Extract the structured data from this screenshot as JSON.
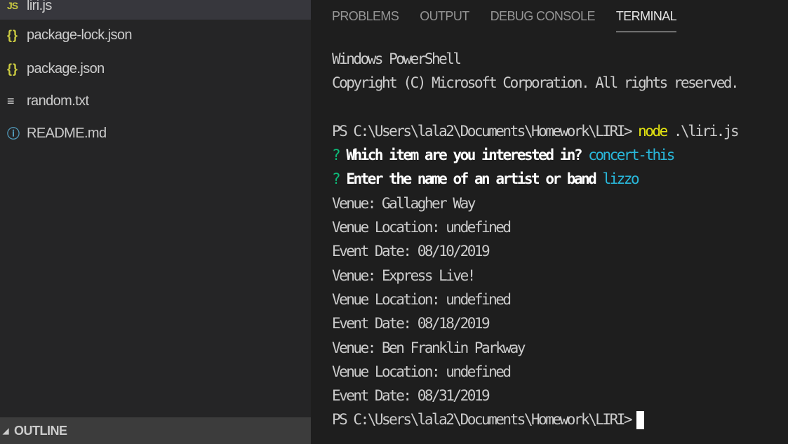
{
  "explorer": {
    "files": [
      {
        "icon": "javascript-file-icon",
        "icon_text": "JS",
        "label": "liri.js"
      },
      {
        "icon": "json-file-icon",
        "icon_text": "{}",
        "label": "package-lock.json"
      },
      {
        "icon": "json-file-icon",
        "icon_text": "{}",
        "label": "package.json"
      },
      {
        "icon": "text-file-icon",
        "icon_text": "≡",
        "label": "random.txt"
      },
      {
        "icon": "info-file-icon",
        "icon_text": "ⓘ",
        "label": "README.md"
      }
    ],
    "outline_label": "OUTLINE"
  },
  "panel": {
    "tabs": [
      "PROBLEMS",
      "OUTPUT",
      "DEBUG CONSOLE",
      "TERMINAL"
    ],
    "active_tab": "TERMINAL"
  },
  "terminal": {
    "header_line1": "Windows PowerShell",
    "header_line2": "Copyright (C) Microsoft Corporation. All rights reserved.",
    "prompt": "PS C:\\Users\\lala2\\Documents\\Homework\\LIRI>",
    "command_node": "node",
    "command_arg": ".\\liri.js",
    "question_mark": "?",
    "q1_text": "Which item are you interested in?",
    "q1_answer": "concert-this",
    "q2_text": "Enter the name of an artist or band",
    "q2_answer": "lizzo",
    "output_lines": [
      "Venue: Gallagher Way",
      "Venue Location: undefined",
      "Event Date: 08/10/2019",
      "Venue: Express Live!",
      "Venue Location: undefined",
      "Event Date: 08/18/2019",
      "Venue: Ben Franklin Parkway",
      "Venue Location: undefined",
      "Event Date: 08/31/2019"
    ]
  },
  "colors": {
    "background": "#1e1e1e",
    "sidebar": "#252526",
    "question_green": "#0dbc79",
    "answer_cyan": "#29b8db",
    "command_yellow": "#e5e510"
  }
}
